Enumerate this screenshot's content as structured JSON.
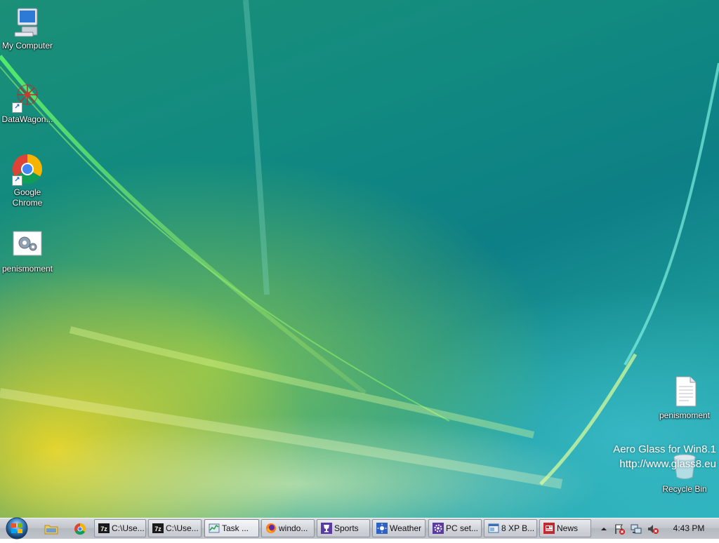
{
  "desktop": {
    "icons": [
      {
        "label": "My Computer"
      },
      {
        "label": "DataWagon..."
      },
      {
        "label": "Google\nChrome"
      },
      {
        "label": "penismoment"
      },
      {
        "label": "penismoment"
      },
      {
        "label": "Recycle Bin"
      }
    ],
    "watermark": {
      "line1": "Aero Glass for Win8.1",
      "line2": "http://www.glass8.eu"
    }
  },
  "taskbar": {
    "buttons": [
      {
        "label": "C:\\Use...",
        "icon": "7zip-icon"
      },
      {
        "label": "C:\\Use...",
        "icon": "7zip-icon"
      },
      {
        "label": "Task ...",
        "icon": "task-manager-icon"
      },
      {
        "label": "windo...",
        "icon": "firefox-icon"
      },
      {
        "label": "Sports",
        "icon": "sports-trophy-icon"
      },
      {
        "label": "Weather",
        "icon": "weather-sun-icon"
      },
      {
        "label": "PC set...",
        "icon": "settings-gear-icon"
      },
      {
        "label": "8 XP B...",
        "icon": "window-app-icon"
      },
      {
        "label": "News",
        "icon": "news-icon"
      }
    ],
    "clock": "4:43 PM"
  }
}
